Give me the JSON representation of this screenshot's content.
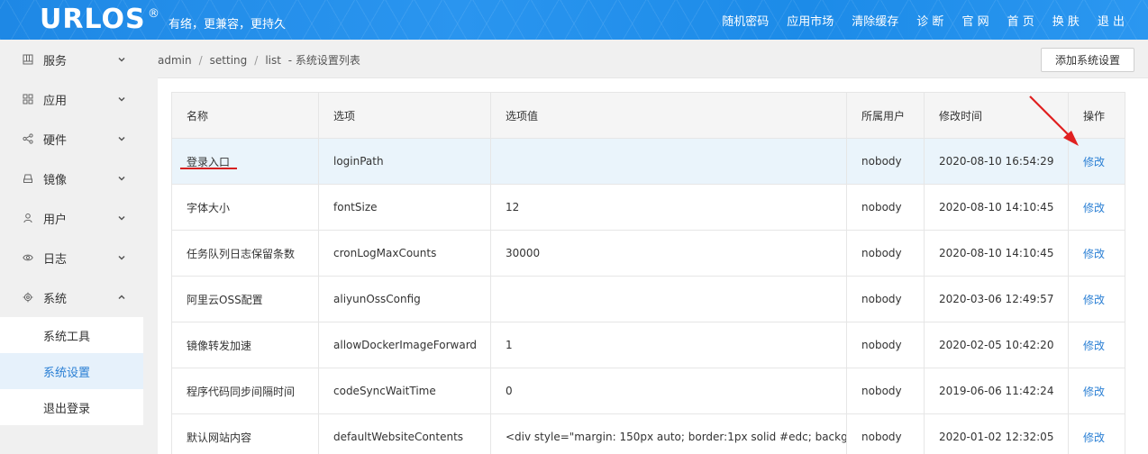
{
  "header": {
    "logo": "URLOS",
    "registered": "®",
    "slogan": "有络，更兼容，更持久",
    "nav": [
      "随机密码",
      "应用市场",
      "清除缓存",
      "诊 断",
      "官 网",
      "首 页",
      "换 肤",
      "退 出"
    ]
  },
  "sidebar": {
    "items": [
      {
        "label": "服务",
        "icon": "grid-icon"
      },
      {
        "label": "应用",
        "icon": "apps-icon"
      },
      {
        "label": "硬件",
        "icon": "share-nodes-icon"
      },
      {
        "label": "镜像",
        "icon": "drive-icon"
      },
      {
        "label": "用户",
        "icon": "user-icon"
      },
      {
        "label": "日志",
        "icon": "eye-icon"
      },
      {
        "label": "系统",
        "icon": "gear-icon"
      }
    ],
    "sub_items": [
      {
        "label": "系统工具",
        "active": false
      },
      {
        "label": "系统设置",
        "active": true
      },
      {
        "label": "退出登录",
        "active": false
      }
    ]
  },
  "breadcrumb": {
    "parts": [
      "admin",
      "setting",
      "list"
    ],
    "suffix": "- 系统设置列表"
  },
  "toolbar": {
    "add_label": "添加系统设置"
  },
  "table": {
    "headers": [
      "名称",
      "选项",
      "选项值",
      "所属用户",
      "修改时间",
      "操作"
    ],
    "rows": [
      {
        "name": "登录入口",
        "option": "loginPath",
        "value": "",
        "user": "nobody",
        "time": "2020-08-10 16:54:29",
        "action": "修改"
      },
      {
        "name": "字体大小",
        "option": "fontSize",
        "value": "12",
        "user": "nobody",
        "time": "2020-08-10 14:10:45",
        "action": "修改"
      },
      {
        "name": "任务队列日志保留条数",
        "option": "cronLogMaxCounts",
        "value": "30000",
        "user": "nobody",
        "time": "2020-08-10 14:10:45",
        "action": "修改"
      },
      {
        "name": "阿里云OSS配置",
        "option": "aliyunOssConfig",
        "value": "",
        "user": "nobody",
        "time": "2020-03-06 12:49:57",
        "action": "修改"
      },
      {
        "name": "镜像转发加速",
        "option": "allowDockerImageForward",
        "value": "1",
        "user": "nobody",
        "time": "2020-02-05 10:42:20",
        "action": "修改"
      },
      {
        "name": "程序代码同步间隔时间",
        "option": "codeSyncWaitTime",
        "value": "0",
        "user": "nobody",
        "time": "2019-06-06 11:42:24",
        "action": "修改"
      },
      {
        "name": "默认网站内容",
        "option": "defaultWebsiteContents",
        "value": "<div style=\"margin: 150px auto; border:1px solid #edc; backg...",
        "user": "nobody",
        "time": "2020-01-02 12:32:05",
        "action": "修改"
      }
    ]
  },
  "colors": {
    "header_blue": "#1e88e5",
    "link_blue": "#2a7fd4",
    "annotation_red": "#d62020",
    "highlight_row": "#eaf4fb"
  }
}
